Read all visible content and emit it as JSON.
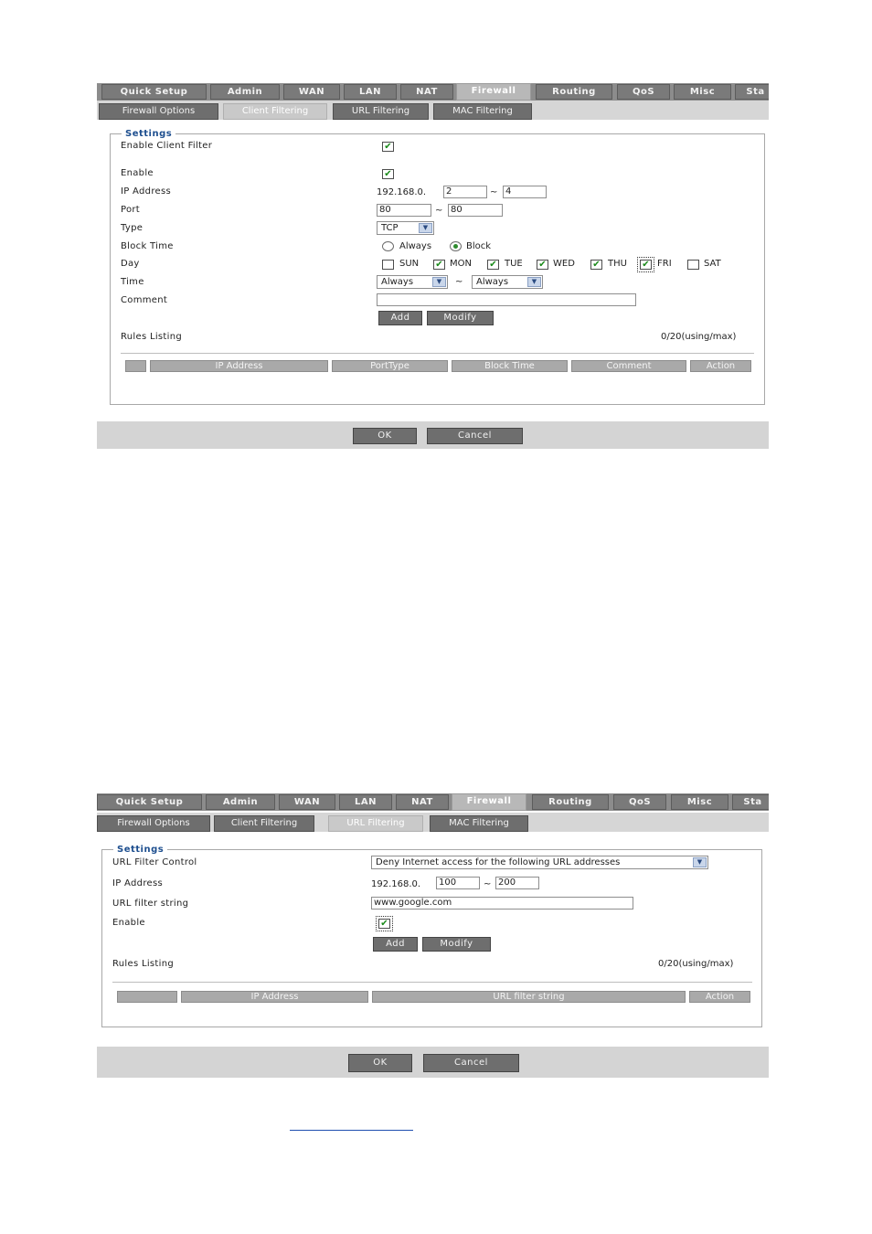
{
  "nav_tabs": [
    "Quick Setup",
    "Admin",
    "WAN",
    "LAN",
    "NAT",
    "Firewall",
    "Routing",
    "QoS",
    "Misc",
    "Sta"
  ],
  "firewall_subtabs": [
    "Firewall Options",
    "Client Filtering",
    "URL Filtering",
    "MAC Filtering"
  ],
  "client_filter": {
    "settings_legend": "Settings",
    "enable_client_filter_label": "Enable Client Filter",
    "enable_label": "Enable",
    "ip_address_label": "IP Address",
    "ip_prefix": "192.168.0.",
    "ip_start": "2",
    "ip_end": "4",
    "port_label": "Port",
    "port_start": "80",
    "port_end": "80",
    "type_label": "Type",
    "type_value": "TCP",
    "block_time_label": "Block Time",
    "always_option": "Always",
    "block_option": "Block",
    "day_label": "Day",
    "days": [
      "SUN",
      "MON",
      "TUE",
      "WED",
      "THU",
      "FRI",
      "SAT"
    ],
    "days_checked": [
      false,
      true,
      true,
      true,
      true,
      true,
      false
    ],
    "time_label": "Time",
    "time_start": "Always",
    "time_end": "Always",
    "comment_label": "Comment",
    "comment_value": "",
    "add_label": "Add",
    "modify_label": "Modify",
    "rules_listing_label": "Rules Listing",
    "rules_count": "0/20(using/max)",
    "columns": [
      "",
      "IP Address",
      "PortType",
      "Block Time",
      "Comment",
      "Action"
    ],
    "ok_label": "OK",
    "cancel_label": "Cancel"
  },
  "url_filter": {
    "settings_legend": "Settings",
    "url_filter_control_label": "URL Filter Control",
    "url_filter_control_value": "Deny Internet access for the following URL addresses",
    "ip_address_label": "IP Address",
    "ip_prefix": "192.168.0.",
    "ip_start": "100",
    "ip_end": "200",
    "url_filter_string_label": "URL filter string",
    "url_filter_string_value": "www.google.com",
    "enable_label": "Enable",
    "add_label": "Add",
    "modify_label": "Modify",
    "rules_listing_label": "Rules Listing",
    "rules_count": "0/20(using/max)",
    "columns": [
      "",
      "IP Address",
      "URL filter string",
      "Action"
    ],
    "ok_label": "OK",
    "cancel_label": "Cancel"
  },
  "tilde": "~",
  "check_mark": "✔",
  "colors": {
    "tab_bg": "#7a7a7a",
    "legend": "#1e4f8f",
    "check": "#1a8a1a",
    "footer_bg": "#d4d4d4"
  }
}
